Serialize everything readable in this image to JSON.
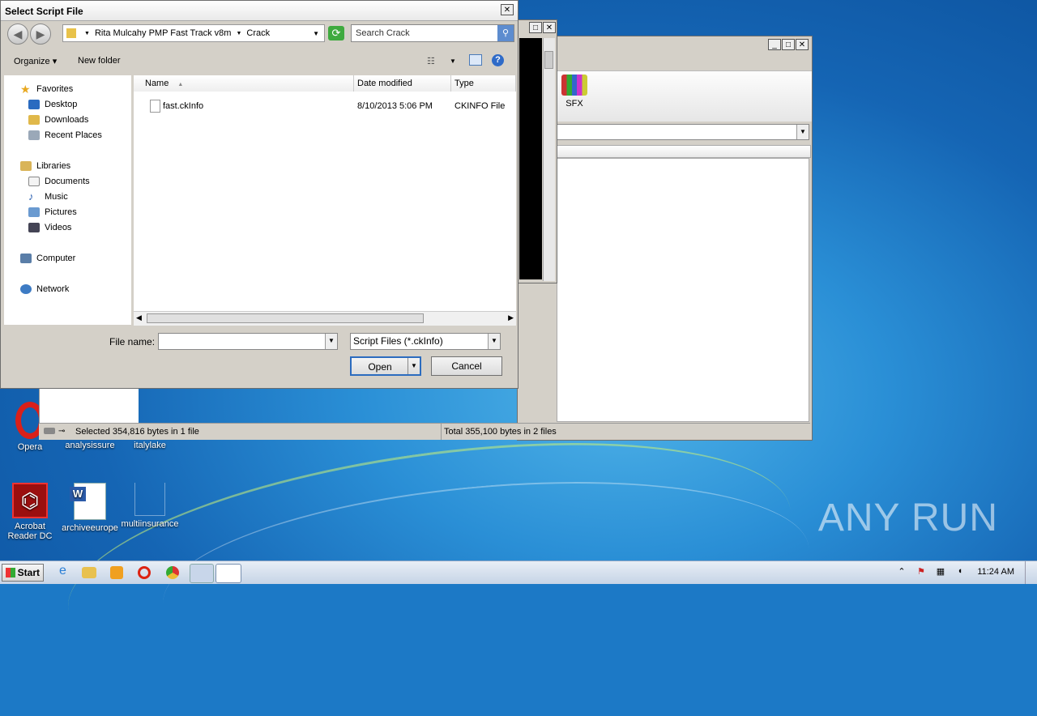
{
  "dialog": {
    "title": "Select Script File",
    "breadcrumb": [
      "Rita Mulcahy PMP Fast Track v8m",
      "Crack"
    ],
    "search_placeholder": "Search Crack",
    "toolbar": {
      "organize": "Organize",
      "new_folder": "New folder"
    },
    "nav": {
      "favorites": "Favorites",
      "favorites_items": [
        "Desktop",
        "Downloads",
        "Recent Places"
      ],
      "libraries": "Libraries",
      "libraries_items": [
        "Documents",
        "Music",
        "Pictures",
        "Videos"
      ],
      "computer": "Computer",
      "network": "Network"
    },
    "columns": [
      "Name",
      "Date modified",
      "Type"
    ],
    "files": [
      {
        "name": "fast.ckInfo",
        "date": "8/10/2013 5:06 PM",
        "type": "CKINFO File"
      }
    ],
    "file_name_label": "File name:",
    "file_name_value": "",
    "filter": "Script Files (*.ckInfo)",
    "open_button": "Open",
    "cancel_button": "Cancel"
  },
  "winrar": {
    "toolbar_item": "SFX",
    "status_left": "Selected 354,816 bytes in 1 file",
    "status_right": "Total 355,100 bytes in 2 files"
  },
  "desktop_icons": [
    {
      "label": "Opera"
    },
    {
      "label": "analysissure"
    },
    {
      "label": "italylake"
    },
    {
      "label": "Acrobat Reader DC"
    },
    {
      "label": "archiveeurope"
    },
    {
      "label": "multiinsurance"
    }
  ],
  "taskbar": {
    "start": "Start",
    "clock": "11:24 AM"
  },
  "watermark": "ANY RUN"
}
